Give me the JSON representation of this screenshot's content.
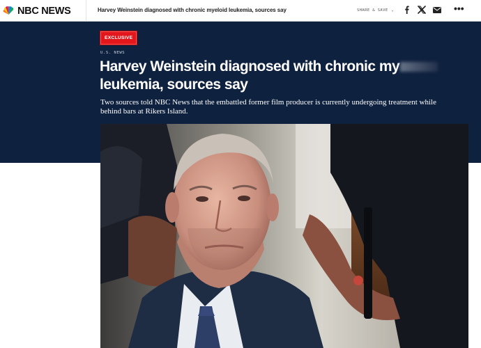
{
  "topbar": {
    "logo_text": "NBC NEWS",
    "headline": "Harvey Weinstein diagnosed with chronic myeloid leukemia, sources say",
    "share_save_label": "SHARE & SAVE",
    "share_save_chevron": "⌄",
    "social_icons": [
      "facebook-icon",
      "x-icon",
      "email-icon"
    ],
    "more_label": "•••"
  },
  "article": {
    "badge": "EXCLUSIVE",
    "section": "U.S. NEWS",
    "headline_visible": "Harvey Weinstein diagnosed with chronic my",
    "headline_line2": "leukemia, sources say",
    "dek": "Two sources told NBC News that the embattled former film producer is currently undergoing treatment while behind bars at Rikers Island."
  },
  "colors": {
    "hero_background": "#0e213f",
    "badge_red": "#e3161b",
    "text_white": "#ffffff"
  }
}
